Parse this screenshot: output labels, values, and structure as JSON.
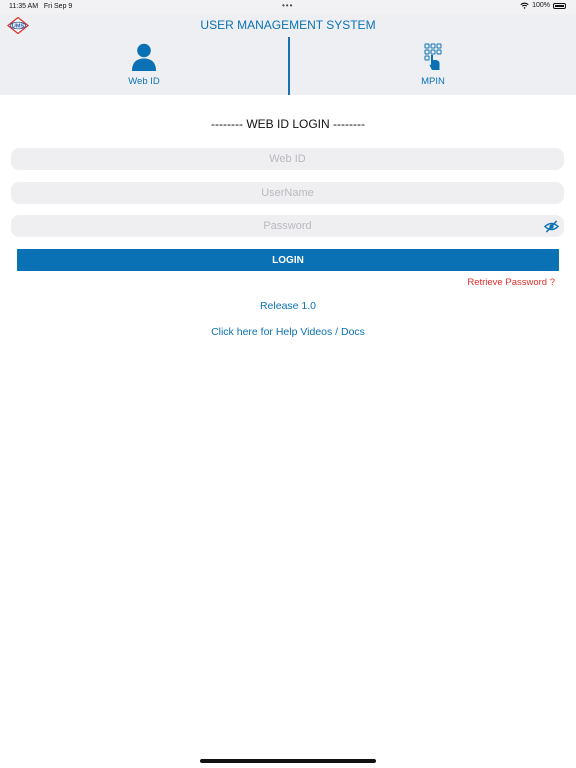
{
  "status_bar": {
    "time": "11:35 AM",
    "date": "Fri Sep 9",
    "dots": "•••",
    "battery_percent": "100%",
    "wifi_icon": "wifi-icon",
    "battery_icon": "battery-full-icon"
  },
  "nav": {
    "title": "USER MANAGEMENT SYSTEM",
    "logo_text": "UMS"
  },
  "tabs": [
    {
      "label": "Web ID",
      "icon": "user-icon",
      "selected": true
    },
    {
      "label": "MPIN",
      "icon": "keypad-hand-icon",
      "selected": false
    }
  ],
  "form": {
    "title": "-------- WEB ID LOGIN --------",
    "webid_placeholder": "Web ID",
    "username_placeholder": "UserName",
    "password_placeholder": "Password",
    "password_toggle_icon": "eye-slash-icon",
    "login_label": "LOGIN",
    "retrieve_label": "Retrieve Password  ?",
    "release": "Release 1.0",
    "help_link": "Click here for Help Videos / Docs"
  },
  "colors": {
    "accent": "#0a72b4",
    "link_red": "#e0302c",
    "field_bg": "#efeff2",
    "bar_bg": "#eeeff2"
  }
}
